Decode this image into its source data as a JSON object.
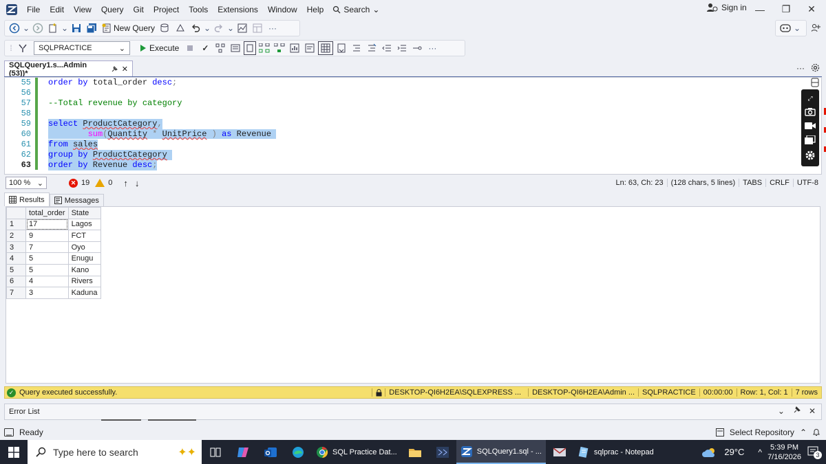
{
  "menu": {
    "items": [
      "File",
      "Edit",
      "View",
      "Query",
      "Git",
      "Project",
      "Tools",
      "Extensions",
      "Window",
      "Help"
    ],
    "search_label": "Search",
    "sign_in": "Sign in"
  },
  "toolbar": {
    "new_query": "New Query",
    "database": "SQLPRACTICE",
    "execute": "Execute"
  },
  "document_tab": {
    "title": "SQLQuery1.s...Admin (53))*"
  },
  "editor": {
    "line_numbers": [
      "55",
      "56",
      "57",
      "58",
      "59",
      "60",
      "61",
      "62",
      "63"
    ],
    "lines": {
      "l55": {
        "kw1": "order by",
        "text": " total_order ",
        "kw2": "desc",
        "op": ";"
      },
      "l57": {
        "comment": "--Total revenue by category"
      },
      "l59": {
        "kw": "select",
        "text": "ProductCategory",
        "op": ","
      },
      "l60": {
        "fn": "sum",
        "op1": "(",
        "col1": "Quantity",
        "op2": " * ",
        "col2": "UnitPrice",
        "op3": " )",
        "kw": "as",
        "alias": "Revenue"
      },
      "l61": {
        "kw": "from",
        "text": "sales"
      },
      "l62": {
        "kw": "group by",
        "text": "ProductCategory"
      },
      "l63": {
        "kw1": "order by",
        "text": " Revenue ",
        "kw2": "desc",
        "op": ";"
      }
    }
  },
  "editor_status": {
    "zoom": "100 %",
    "errors": "19",
    "warnings": "0",
    "position": "Ln: 63, Ch: 23",
    "chars": "(128 chars, 5 lines)",
    "tabs": "TABS",
    "line_ending": "CRLF",
    "encoding": "UTF-8"
  },
  "results": {
    "tab_results": "Results",
    "tab_messages": "Messages",
    "columns": [
      "total_order",
      "State"
    ],
    "rows": [
      {
        "n": "1",
        "total_order": "17",
        "state": "Lagos"
      },
      {
        "n": "2",
        "total_order": "9",
        "state": "FCT"
      },
      {
        "n": "3",
        "total_order": "7",
        "state": "Oyo"
      },
      {
        "n": "4",
        "total_order": "5",
        "state": "Enugu"
      },
      {
        "n": "5",
        "total_order": "5",
        "state": "Kano"
      },
      {
        "n": "6",
        "total_order": "4",
        "state": "Rivers"
      },
      {
        "n": "7",
        "total_order": "3",
        "state": "Kaduna"
      }
    ]
  },
  "query_status": {
    "message": "Query executed successfully.",
    "server": "DESKTOP-QI6H2EA\\SQLEXPRESS ...",
    "user": "DESKTOP-QI6H2EA\\Admin ...",
    "database": "SQLPRACTICE",
    "time": "00:00:00",
    "rowcol": "Row: 1, Col: 1",
    "rows": "7 rows"
  },
  "error_list": {
    "title": "Error List"
  },
  "vs_status": {
    "ready": "Ready",
    "repo": "Select Repository"
  },
  "taskbar": {
    "search_placeholder": "Type here to search",
    "apps": [
      "SQL Practice Dat...",
      "SQLQuery1.sql - ...",
      "sqlprac - Notepad"
    ],
    "temperature": "29°C",
    "time": "5:39 PM",
    "date": "7/16/2026",
    "notifications": "3"
  },
  "colors": {
    "accent": "#0078d4",
    "selection": "#aed1f3",
    "status_yellow": "#f5df6d",
    "taskbar": "#1f2430"
  }
}
